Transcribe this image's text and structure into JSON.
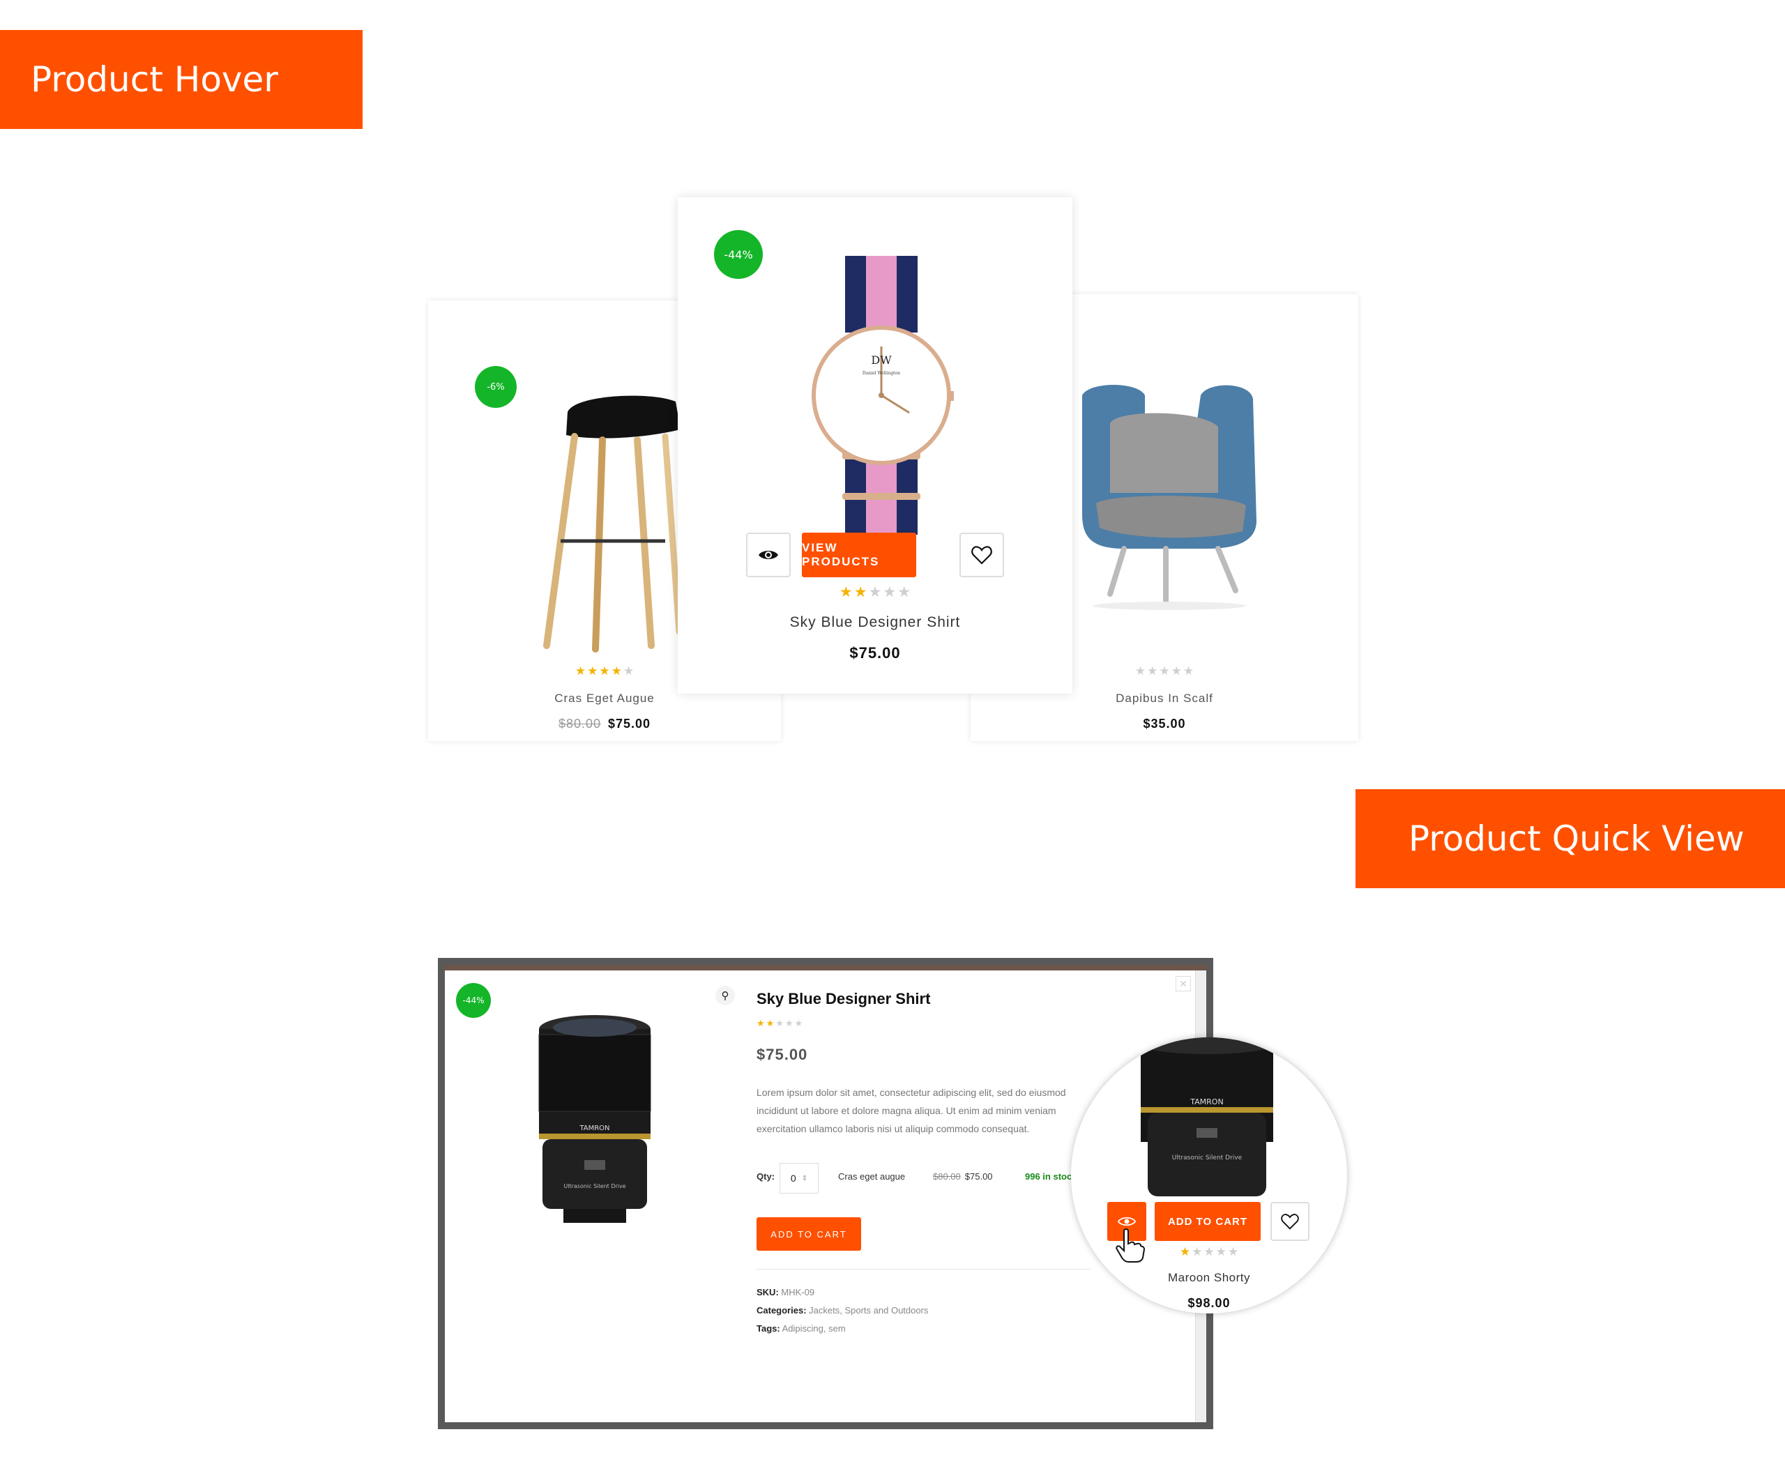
{
  "banners": {
    "hover": "Product Hover",
    "quick_view": "Product Quick View"
  },
  "colors": {
    "accent": "#ff5000",
    "badge": "#14b528",
    "star": "#f5b301",
    "in_stock": "#1a8a1a"
  },
  "hover_section": {
    "left_card": {
      "badge": "-6%",
      "rating": 4,
      "name": "Cras Eget Augue",
      "old_price": "$80.00",
      "price": "$75.00"
    },
    "center_card": {
      "badge": "-44%",
      "rating": 2,
      "name": "Sky Blue Designer Shirt",
      "price": "$75.00",
      "view_button": "VIEW PRODUCTS",
      "watch_brand": "DW",
      "watch_brand_sub": "Daniel Wellington"
    },
    "right_card": {
      "rating": 0,
      "name": "Dapibus In Scalf",
      "price": "$35.00"
    }
  },
  "quick_view": {
    "badge": "-44%",
    "title": "Sky Blue Designer Shirt",
    "rating": 2,
    "price": "$75.00",
    "description": "Lorem ipsum dolor sit amet, consectetur adipiscing elit, sed do eiusmod\nincididunt ut labore et dolore magna aliqua. Ut enim ad minim veniam\nexercitation ullamco laboris nisi ut aliquip commodo consequat.",
    "qty_label": "Qty:",
    "qty_value": "0",
    "variant_name": "Cras eget augue",
    "variant_old_price": "$80.00",
    "variant_price": "$75.00",
    "stock": "996 in stock",
    "add_to_cart": "ADD TO CART",
    "sku_label": "SKU:",
    "sku": "MHK-09",
    "categories_label": "Categories:",
    "category_1": "Jackets",
    "category_2": "Sports and Outdoors",
    "tags_label": "Tags:",
    "tag_1": "Adipiscing",
    "tag_2": "sem",
    "lens_brand": "TAMRON",
    "lens_text": "Ultrasonic Silent Drive"
  },
  "magnified_card": {
    "add_to_cart": "ADD TO CART",
    "rating": 1,
    "name": "Maroon Shorty",
    "price": "$98.00"
  }
}
